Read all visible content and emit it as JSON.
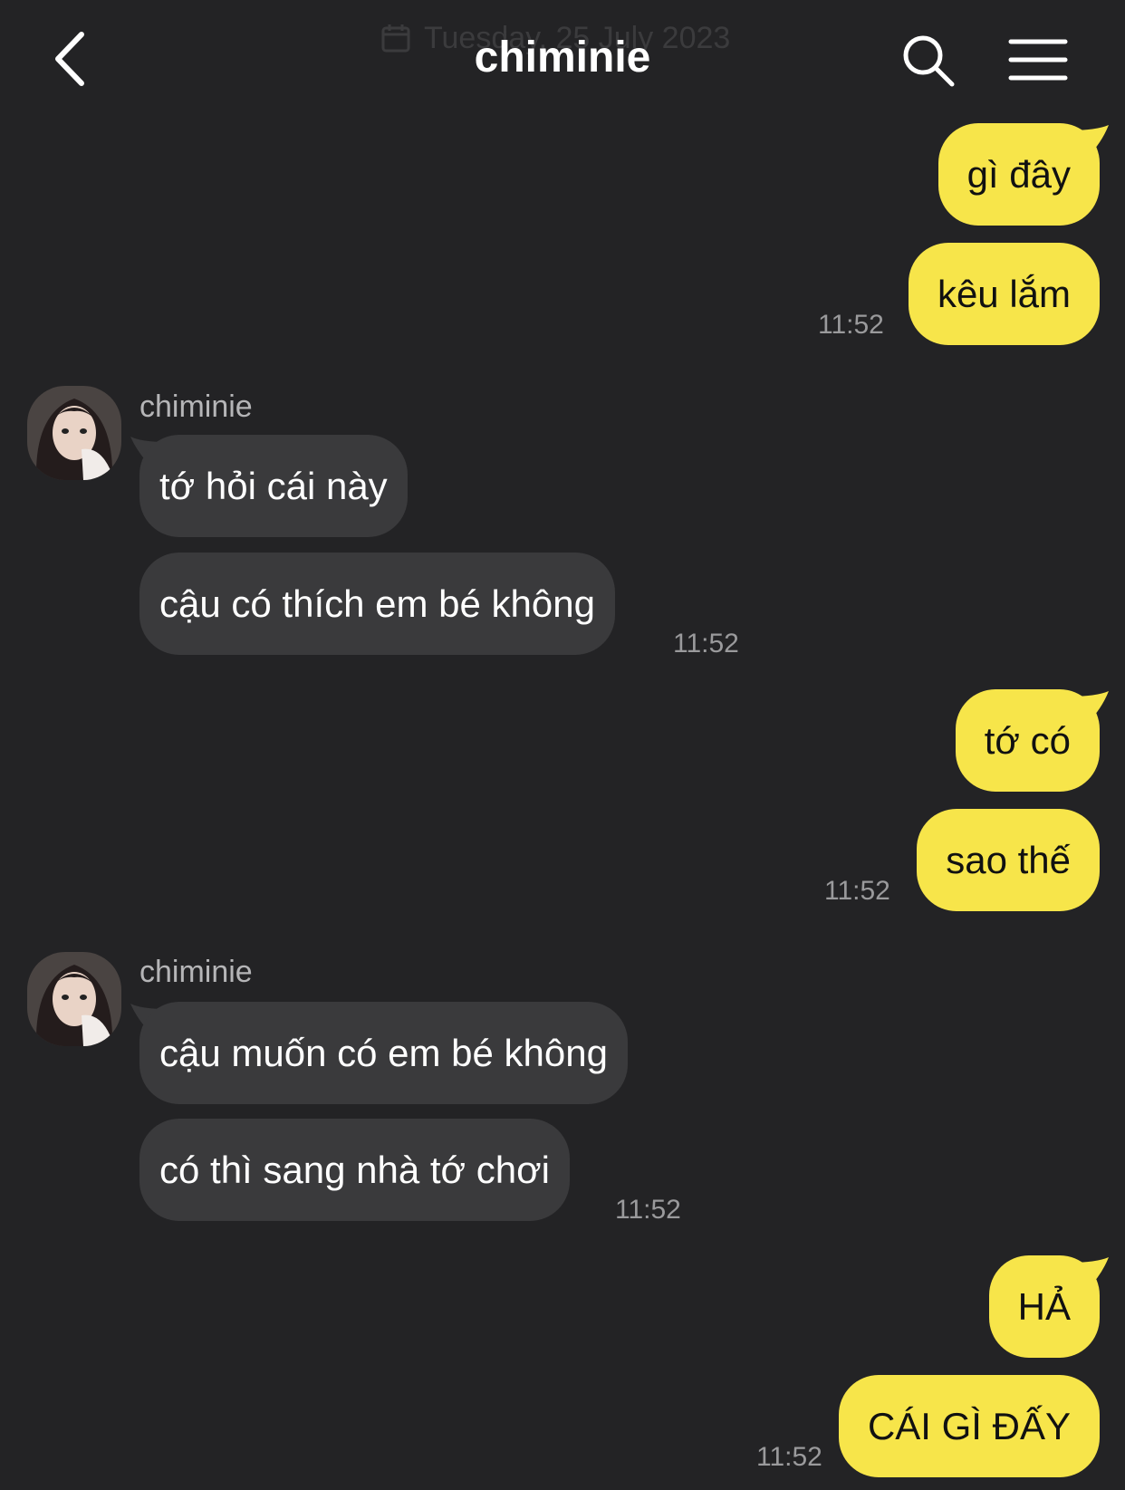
{
  "header": {
    "title": "chiminie",
    "date_overlay": "Tuesday, 25 July 2023"
  },
  "chat": {
    "contact_name": "chiminie",
    "groups": [
      {
        "from": "me",
        "messages": [
          "gì đây",
          "kêu lắm"
        ],
        "time": "11:52"
      },
      {
        "from": "chiminie",
        "messages": [
          "tớ hỏi cái này",
          "cậu có thích em bé không"
        ],
        "time": "11:52"
      },
      {
        "from": "me",
        "messages": [
          "tớ có",
          "sao thế"
        ],
        "time": "11:52"
      },
      {
        "from": "chiminie",
        "messages": [
          "cậu muốn có em bé không",
          "có thì sang nhà tớ chơi"
        ],
        "time": "11:52"
      },
      {
        "from": "me",
        "messages": [
          "HẢ",
          "CÁI GÌ ĐẤY"
        ],
        "time": "11:52"
      }
    ]
  },
  "colors": {
    "background": "#232325",
    "my_bubble": "#f7e54a",
    "their_bubble": "#3a3a3c",
    "timestamp": "#9a9a9c"
  },
  "icons": [
    "back-chevron-icon",
    "search-icon",
    "menu-icon",
    "calendar-icon",
    "avatar"
  ]
}
